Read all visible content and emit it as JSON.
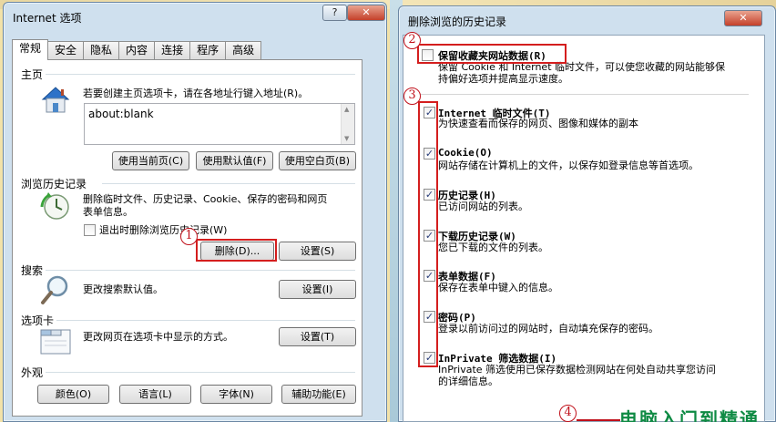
{
  "left_dialog": {
    "title": "Internet 选项",
    "help": "?",
    "close": "✕",
    "tabs": [
      "常规",
      "安全",
      "隐私",
      "内容",
      "连接",
      "程序",
      "高级"
    ],
    "homepage": {
      "group": "主页",
      "hint": "若要创建主页选项卡，请在各地址行键入地址(R)。",
      "value": "about:blank",
      "btn_current": "使用当前页(C)",
      "btn_default": "使用默认值(F)",
      "btn_blank": "使用空白页(B)"
    },
    "history": {
      "group": "浏览历史记录",
      "desc_1": "删除临时文件、历史记录、Cookie、保存的密码和网页",
      "desc_2": "表单信息。",
      "checkbox_label": "退出时删除浏览历史记录(W)",
      "btn_delete": "删除(D)...",
      "btn_settings": "设置(S)"
    },
    "search": {
      "group": "搜索",
      "desc": "更改搜索默认值。",
      "btn_settings": "设置(I)"
    },
    "tabs_group": {
      "group": "选项卡",
      "desc": "更改网页在选项卡中显示的方式。",
      "btn_settings": "设置(T)"
    },
    "appearance": {
      "group": "外观",
      "btn_colors": "颜色(O)",
      "btn_languages": "语言(L)",
      "btn_fonts": "字体(N)",
      "btn_accessibility": "辅助功能(E)"
    }
  },
  "right_dialog": {
    "title": "删除浏览的历史记录",
    "close": "✕",
    "items": [
      {
        "title": "保留收藏夹网站数据(R)",
        "desc": "保留 Cookie 和 Internet 临时文件，可以使您收藏的网站能够保持偏好选项并提高显示速度。",
        "checked": false
      },
      {
        "title": "Internet 临时文件(T)",
        "desc": "为快速查看而保存的网页、图像和媒体的副本",
        "checked": true
      },
      {
        "title": "Cookie(O)",
        "desc": "网站存储在计算机上的文件，以保存如登录信息等首选项。",
        "checked": true
      },
      {
        "title": "历史记录(H)",
        "desc": "已访问网站的列表。",
        "checked": true
      },
      {
        "title": "下载历史记录(W)",
        "desc": "您已下载的文件的列表。",
        "checked": true
      },
      {
        "title": "表单数据(F)",
        "desc": "保存在表单中键入的信息。",
        "checked": true
      },
      {
        "title": "密码(P)",
        "desc": "登录以前访问过的网站时，自动填充保存的密码。",
        "checked": true
      },
      {
        "title": "InPrivate 筛选数据(I)",
        "desc": "InPrivate 筛选使用已保存数据检测网站在何处自动共享您访问的详细信息。",
        "checked": true
      }
    ],
    "item0_desc_line1": "保留 Cookie 和 Internet 临时文件，可以使您收藏的网站能够保",
    "item0_desc_line2": "持偏好选项并提高显示速度。",
    "item7_desc_line1": "InPrivate 筛选使用已保存数据检测网站在何处自动共享您访问",
    "item7_desc_line2": "的详细信息。"
  },
  "annotations": {
    "num1": "1",
    "num2": "2",
    "num3": "3",
    "num4": "4"
  },
  "watermark": "电脑入门到精通",
  "colors": {
    "annotation_red": "#d41e1e",
    "check_blue": "#2a3e7a",
    "watermark_green": "#0e8a43"
  }
}
